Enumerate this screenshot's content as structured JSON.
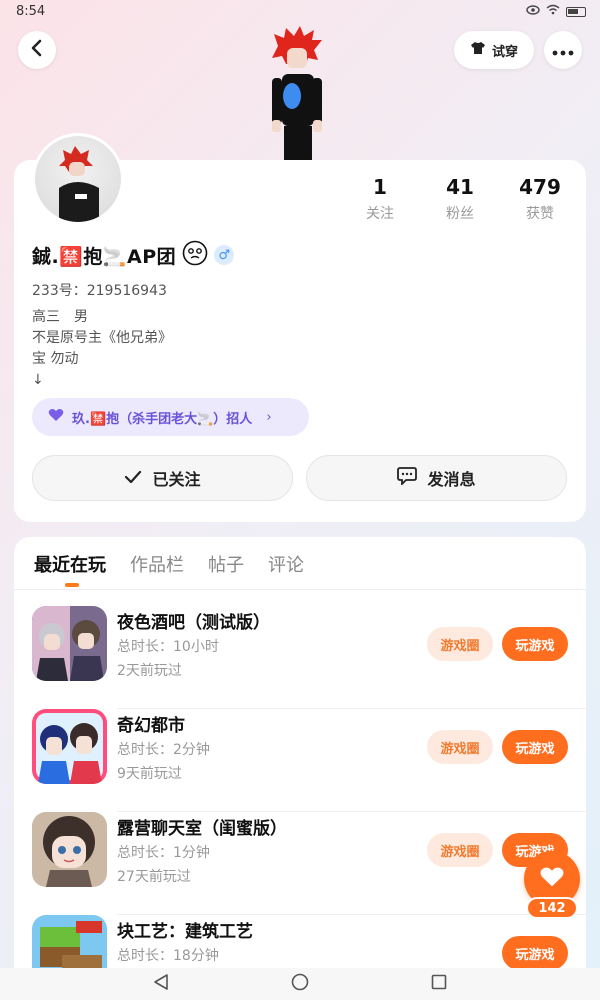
{
  "status_bar": {
    "time": "8:54"
  },
  "header": {
    "try_on_label": "试穿"
  },
  "stats": [
    {
      "value": "1",
      "label": "关注"
    },
    {
      "value": "41",
      "label": "粉丝"
    },
    {
      "value": "479",
      "label": "获赞"
    }
  ],
  "profile": {
    "nickname": "鋮.🈲抱🚬AP团",
    "gender": "♂",
    "user_id": "233号：219516943",
    "bio": [
      "高三　男",
      "不是原号主《他兄弟》",
      "宝 勿动",
      "↓"
    ]
  },
  "group_chip": {
    "label": "玖.🈲抱（杀手团老大🚬）招人"
  },
  "actions": {
    "follow_label": "已关注",
    "message_label": "发消息"
  },
  "tabs": [
    "最近在玩",
    "作品栏",
    "帖子",
    "评论"
  ],
  "games": [
    {
      "name": "夜色酒吧（测试版）",
      "duration": "总时长：10小时",
      "last_played": "2天前玩过",
      "circle_label": "游戏圈",
      "play_label": "玩游戏",
      "colors": [
        "#d8b7cf",
        "#5b4a6e"
      ]
    },
    {
      "name": "奇幻都市",
      "duration": "总时长：2分钟",
      "last_played": "9天前玩过",
      "circle_label": "游戏圈",
      "play_label": "玩游戏",
      "colors": [
        "#ff4d7d",
        "#2a6de0"
      ]
    },
    {
      "name": "露营聊天室（闺蜜版）",
      "duration": "总时长：1分钟",
      "last_played": "27天前玩过",
      "circle_label": "游戏圈",
      "play_label": "玩游戏",
      "colors": [
        "#e8d4c0",
        "#4a3a33"
      ]
    },
    {
      "name": "块工艺：建筑工艺",
      "duration": "总时长：18分钟",
      "last_played": "",
      "circle_label": "",
      "play_label": "玩游戏",
      "colors": [
        "#6bbf3a",
        "#8a5a2b"
      ]
    }
  ],
  "like": {
    "count": "142"
  },
  "theme": {
    "accent": "#ff6d1f",
    "chip_bg": "#ece9fd",
    "chip_text": "#6952d8"
  }
}
